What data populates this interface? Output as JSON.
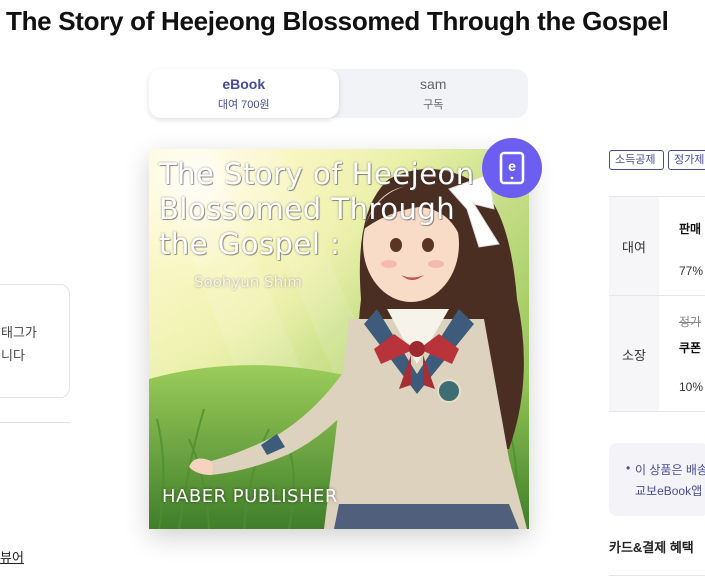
{
  "product": {
    "title": "The Story of Heejeong Blossomed Through the Gospel"
  },
  "format_tabs": [
    {
      "name": "eBook",
      "sub": "대여 700원"
    },
    {
      "name": "sam",
      "sub": "구독"
    }
  ],
  "cover": {
    "title_lines": [
      "The Story of Heejeon",
      "Blossomed Through",
      "the Gospel  :"
    ],
    "author": "Soohyun Shim",
    "publisher": "HABER PUBLISHER",
    "badge_icon": "ebook-tablet-icon",
    "badge_letter": "e",
    "badge_color": "#6b5ef0"
  },
  "left_panel": {
    "card_lines": [
      "태그가",
      "니다"
    ],
    "link": "뷰어"
  },
  "right_panel": {
    "tags": [
      "소득공제",
      "정가제"
    ],
    "price_rows": [
      {
        "label": "대여",
        "line1": "판매",
        "line2": "77%"
      },
      {
        "label": "소장",
        "line0": "정가",
        "line1": "쿠폰",
        "line2": "10%"
      }
    ],
    "notice_line1": "이 상품은 배송",
    "notice_line2": "교보eBook앱",
    "benefit_title": "카드&결제 혜택"
  },
  "colors": {
    "accent": "#474c98",
    "badge": "#6b5ef0"
  }
}
